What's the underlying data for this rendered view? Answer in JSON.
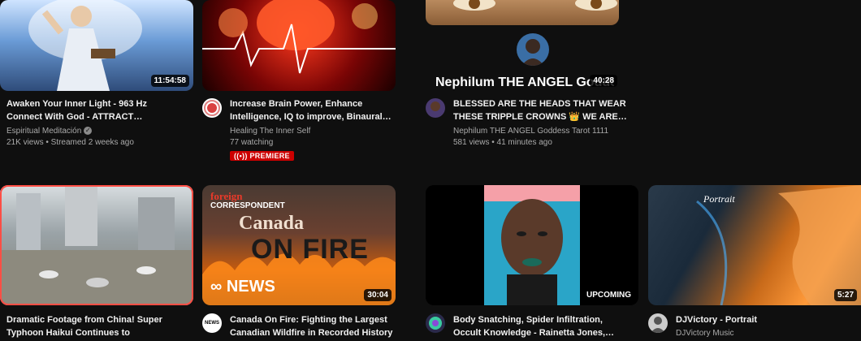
{
  "videos_row1": [
    {
      "title": "Awaken Your Inner Light - 963 Hz Connect With God - ATTRACT…",
      "channel": "Espiritual Meditación",
      "verified": true,
      "stats": "21K views • Streamed 2 weeks ago",
      "duration": "11:54:58"
    },
    {
      "title": "Increase Brain Power, Enhance Intelligence, IQ to improve, Binaural…",
      "channel": "Healing The Inner Self",
      "stats": "77 watching",
      "badge": "PREMIERE"
    },
    {
      "title": "BLESSED ARE THE HEADS THAT WEAR THESE TRIPPLE CROWNS 👑 WE ARE…",
      "channel": "Nephilum THE ANGEL Goddess Tarot 1111",
      "stats": "581 views • 41 minutes ago",
      "duration": "40:28",
      "overlay_name": "Nephilum THE ANGEL Godde"
    }
  ],
  "videos_row2": [
    {
      "title": "Dramatic Footage from China! Super Typhoon Haikui Continues to Bombard…",
      "channel": "",
      "stats": ""
    },
    {
      "title": "Canada On Fire: Fighting the Largest Canadian Wildfire in Recorded History |…",
      "channel": "",
      "duration": "30:04",
      "thumb_brand_top": "foreign",
      "thumb_brand_sub": "CORRESPONDENT",
      "thumb_headline_1": "Canada",
      "thumb_headline_2": "ON FIRE",
      "thumb_logo": "NEWS",
      "avatar_text": "NEWS"
    },
    {
      "title": "Body Snatching, Spider Infiltration, Occult Knowledge - Rainetta Jones,…",
      "channel": "",
      "duration": "UPCOMING"
    },
    {
      "title": "DJVictory - Portrait",
      "channel": "DJVictory Music",
      "duration": "5:27",
      "thumb_text": "Portrait"
    }
  ],
  "colors": {
    "background": "#0f0f0f",
    "text_primary": "#f1f1f1",
    "text_secondary": "#aaaaaa",
    "premiere_red": "#cc0000",
    "selected_outline": "#ff4e45"
  }
}
